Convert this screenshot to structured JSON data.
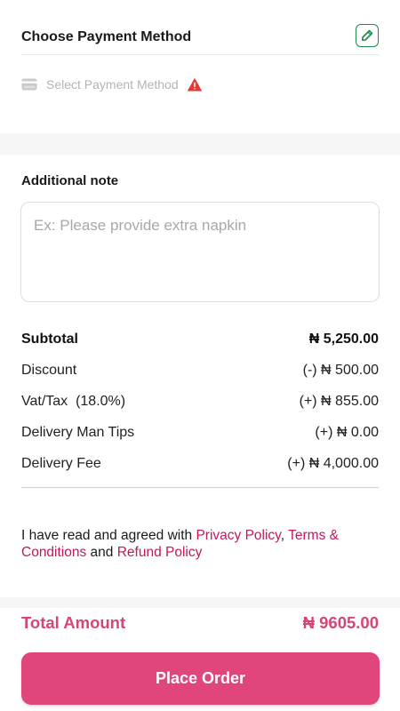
{
  "payment": {
    "title": "Choose Payment Method",
    "select_label": "Select Payment Method",
    "edit_icon": "edit-icon",
    "card_icon": "card-icon",
    "warning_icon": "warning-icon"
  },
  "note": {
    "title": "Additional note",
    "placeholder": "Ex: Please provide extra napkin",
    "value": ""
  },
  "summary": {
    "rows": [
      {
        "label": "Subtotal",
        "value": "₦ 5,250.00"
      },
      {
        "label": "Discount",
        "value": "(-) ₦ 500.00"
      },
      {
        "label": "Vat/Tax  (18.0%)",
        "value": "(+) ₦ 855.00"
      },
      {
        "label": "Delivery Man Tips",
        "value": "(+) ₦ 0.00"
      },
      {
        "label": "Delivery Fee",
        "value": "(+) ₦ 4,000.00"
      }
    ]
  },
  "agreement": {
    "prefix": "I have read and agreed with ",
    "privacy": "Privacy Policy",
    "sep1": ", ",
    "terms": "Terms & Conditions",
    "sep2": " and ",
    "refund": "Refund Policy"
  },
  "total": {
    "label": "Total Amount",
    "value": "₦ 9605.00"
  },
  "place_order": "Place Order",
  "colors": {
    "accent": "#e0467c",
    "link": "#c2185b",
    "edit_green": "#1f8a4c",
    "warning_red": "#e53935"
  }
}
